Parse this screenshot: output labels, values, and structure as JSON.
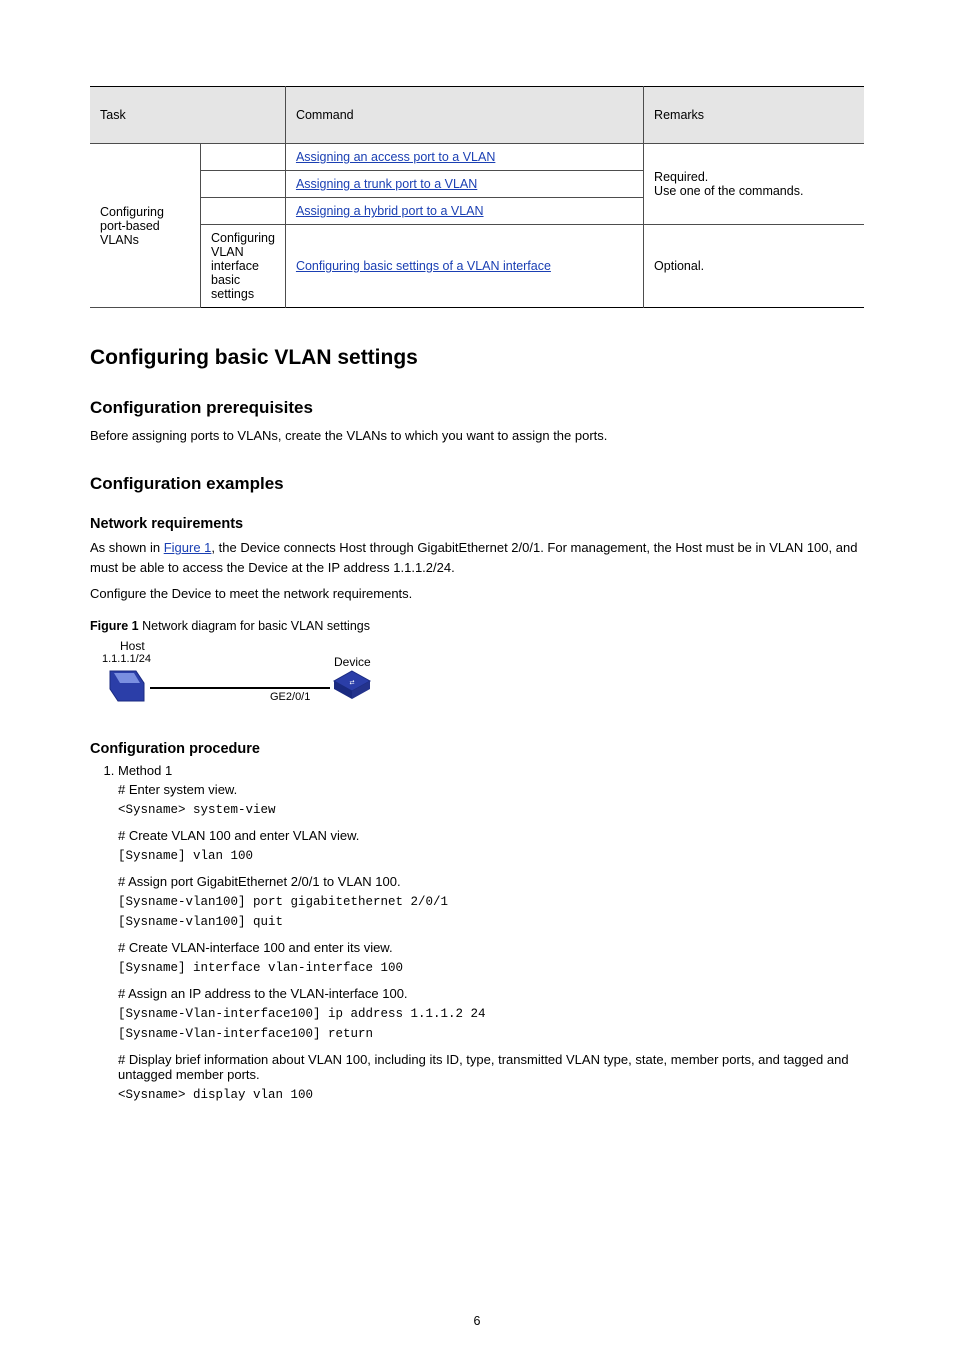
{
  "table": {
    "headers": [
      "Task",
      "Command",
      "Remarks"
    ],
    "header_col1": "Task",
    "rows": [
      {
        "c1": "Configuring port-based VLANs",
        "c2_link": "Assigning an access port to a VLAN",
        "c3": "Required."
      },
      {
        "c1": "",
        "c2_link": "Assigning a trunk port to a VLAN",
        "c3": "Use one of the commands."
      },
      {
        "c1": "",
        "c2_link": "Assigning a hybrid port to a VLAN",
        "c3": ""
      },
      {
        "c1": "Configuring VLAN interface basic settings",
        "c2_link": "Configuring basic settings of a VLAN interface",
        "c3": "Optional."
      }
    ]
  },
  "h1": "Configuring basic VLAN settings",
  "h2a": "Configuration prerequisites",
  "p1": "Before assigning ports to VLANs, create the VLANs to which you want to assign the ports.",
  "h2b": "Configuration examples",
  "h3a": "Network requirements",
  "p2_pre": "As shown in ",
  "p2_link": "Figure 1",
  "p2_post": ", the Device connects Host through GigabitEthernet 2/0/1. For management, the Host must be in VLAN 100, and must be able to access the Device at the IP address 1.1.1.2/24.",
  "p3": "Configure the Device to meet the network requirements.",
  "figcap_bold": "Figure 1",
  "figcap_rest": " Network diagram for basic VLAN settings",
  "diagram": {
    "host_label": "Host",
    "host_ip": "1.1.1.1/24",
    "port_label": "GE2/0/1",
    "device_label": "Device"
  },
  "h3b": "Configuration procedure",
  "steps": [
    {
      "label": "Method 1",
      "desc_a": "# Enter system view.",
      "cli_a": "<Sysname> system-view",
      "desc_b": "# Create VLAN 100 and enter VLAN view.",
      "cli_b": "[Sysname] vlan 100",
      "desc_c": "# Assign port GigabitEthernet 2/0/1 to VLAN 100.",
      "cli_c": "[Sysname-vlan100] port gigabitethernet 2/0/1\n[Sysname-vlan100] quit",
      "desc_d": "# Create VLAN-interface 100 and enter its view.",
      "cli_d": "[Sysname] interface vlan-interface 100",
      "desc_e": "# Assign an IP address to the VLAN-interface 100.",
      "cli_e": "[Sysname-Vlan-interface100] ip address 1.1.1.2 24\n[Sysname-Vlan-interface100] return",
      "desc_f": "# Display brief information about VLAN 100, including its ID, type, transmitted VLAN type, state, member ports, and tagged and untagged member ports.",
      "cli_f": "<Sysname> display vlan 100"
    }
  ],
  "page_number": "6"
}
